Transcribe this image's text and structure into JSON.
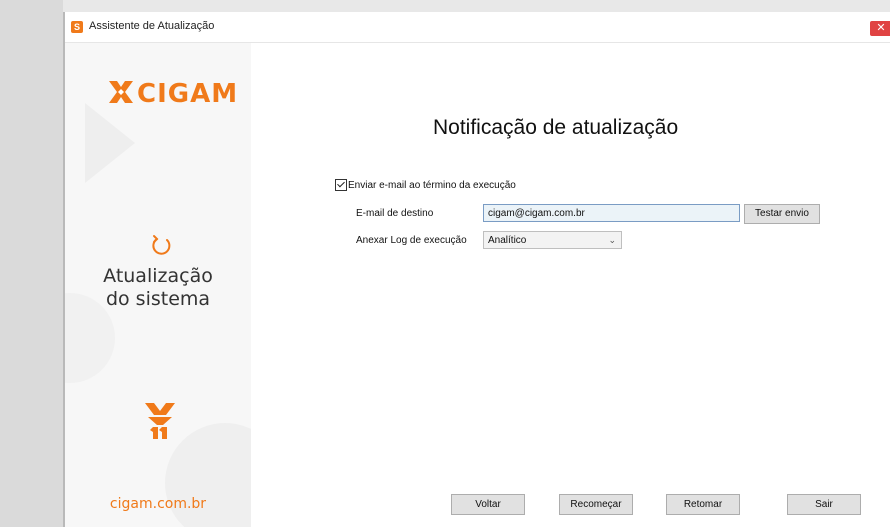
{
  "window": {
    "title": "Assistente de Atualização",
    "app_icon": "S",
    "close_glyph": "✕"
  },
  "sidebar": {
    "logo_text": "CIGAM",
    "title_line1": "Atualização",
    "title_line2": "do sistema",
    "site": "cigam.com.br",
    "accent": "#f07a1a"
  },
  "main": {
    "title": "Notificação de atualização",
    "notify_checkbox": {
      "label": "Enviar e-mail ao término da execução",
      "checked": true
    },
    "email_label": "E-mail de destino",
    "email_value": "cigam@cigam.com.br",
    "test_button": "Testar envio",
    "log_label": "Anexar Log de execução",
    "log_value": "Analítico"
  },
  "footer": {
    "back": "Voltar",
    "restart": "Recomeçar",
    "resume": "Retomar",
    "exit": "Sair"
  }
}
